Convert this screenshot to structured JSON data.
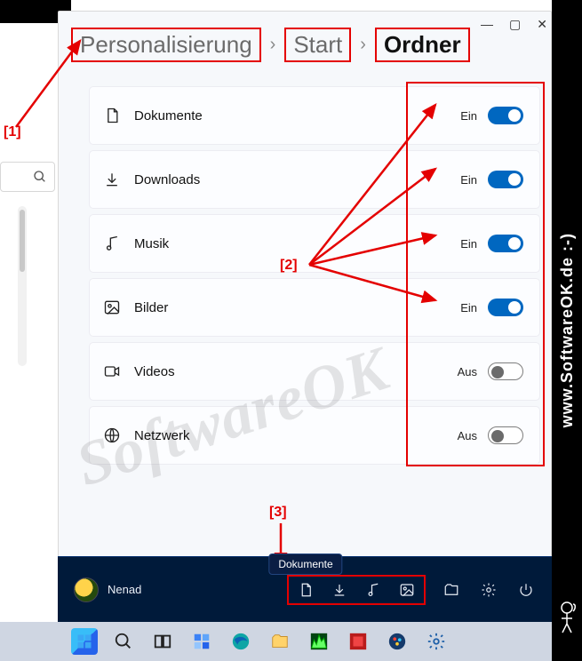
{
  "branding": {
    "side_text": "www.SoftwareOK.de :-)"
  },
  "window": {
    "breadcrumb": {
      "level1": "Personalisierung",
      "level2": "Start",
      "level3": "Ordner"
    }
  },
  "settings_items": [
    {
      "key": "dokumente",
      "label": "Dokumente",
      "state": "Ein",
      "on": true
    },
    {
      "key": "downloads",
      "label": "Downloads",
      "state": "Ein",
      "on": true
    },
    {
      "key": "musik",
      "label": "Musik",
      "state": "Ein",
      "on": true
    },
    {
      "key": "bilder",
      "label": "Bilder",
      "state": "Ein",
      "on": true
    },
    {
      "key": "videos",
      "label": "Videos",
      "state": "Aus",
      "on": false
    },
    {
      "key": "netzwerk",
      "label": "Netzwerk",
      "state": "Aus",
      "on": false
    }
  ],
  "startmenu": {
    "tooltip": "Dokumente",
    "user_name": "Nenad"
  },
  "annotations": {
    "a1": "[1]",
    "a2": "[2]",
    "a3": "[3]"
  },
  "watermark": "SoftwareOK"
}
